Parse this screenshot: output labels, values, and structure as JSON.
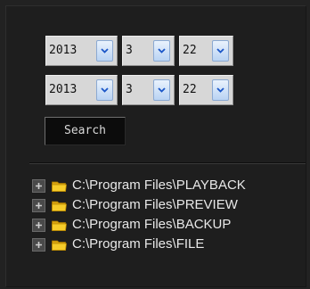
{
  "date_range": {
    "from": {
      "year": "2013",
      "month": "3",
      "day": "22"
    },
    "to": {
      "year": "2013",
      "month": "3",
      "day": "22"
    }
  },
  "search_button": {
    "label": "Search"
  },
  "tree": {
    "items": [
      {
        "label": "C:\\Program Files\\PLAYBACK",
        "expander_icon": "plus-box-icon",
        "icon": "folder-icon",
        "expanded": false
      },
      {
        "label": "C:\\Program Files\\PREVIEW",
        "expander_icon": "plus-box-icon",
        "icon": "folder-icon",
        "expanded": false
      },
      {
        "label": "C:\\Program Files\\BACKUP",
        "expander_icon": "plus-box-icon",
        "icon": "folder-icon",
        "expanded": false
      },
      {
        "label": "C:\\Program Files\\FILE",
        "expander_icon": "plus-box-icon",
        "icon": "folder-icon",
        "expanded": false
      }
    ]
  },
  "colors": {
    "background": "#222222",
    "text": "#e8e8e8",
    "select_bg": "#d7d7d7",
    "dropdown_arrow": "#1a56c8",
    "folder": "#f2c21a"
  }
}
